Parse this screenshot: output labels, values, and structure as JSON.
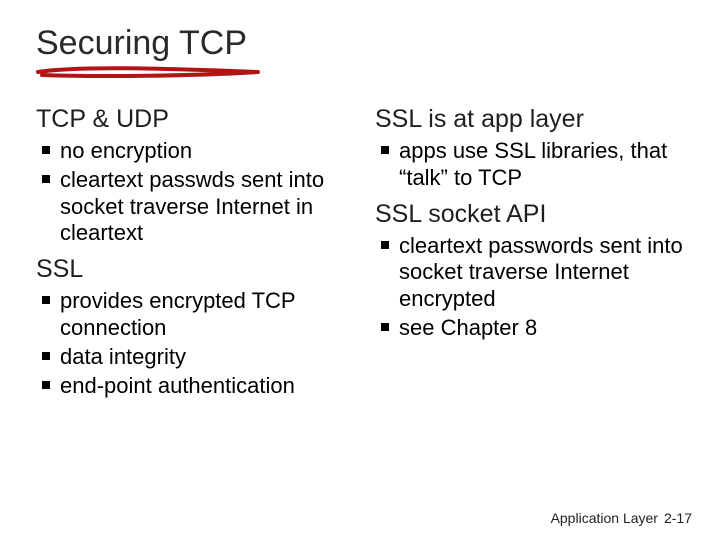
{
  "title": "Securing TCP",
  "left": {
    "head1": "TCP & UDP",
    "bullets1": [
      "no encryption",
      "cleartext passwds sent into socket traverse Internet  in cleartext"
    ],
    "head2": "SSL",
    "bullets2": [
      "provides encrypted TCP connection",
      "data integrity",
      "end-point authentication"
    ]
  },
  "right": {
    "head1": "SSL is at app layer",
    "bullets1": [
      " apps use SSL libraries, that “talk” to TCP"
    ],
    "head2": "SSL socket API",
    "bullets2": [
      "cleartext passwords sent into socket traverse Internet  encrypted",
      "see Chapter 8"
    ]
  },
  "footer": {
    "label": "Application Layer",
    "page": "2-17"
  },
  "colors": {
    "underline": "#b01513"
  }
}
